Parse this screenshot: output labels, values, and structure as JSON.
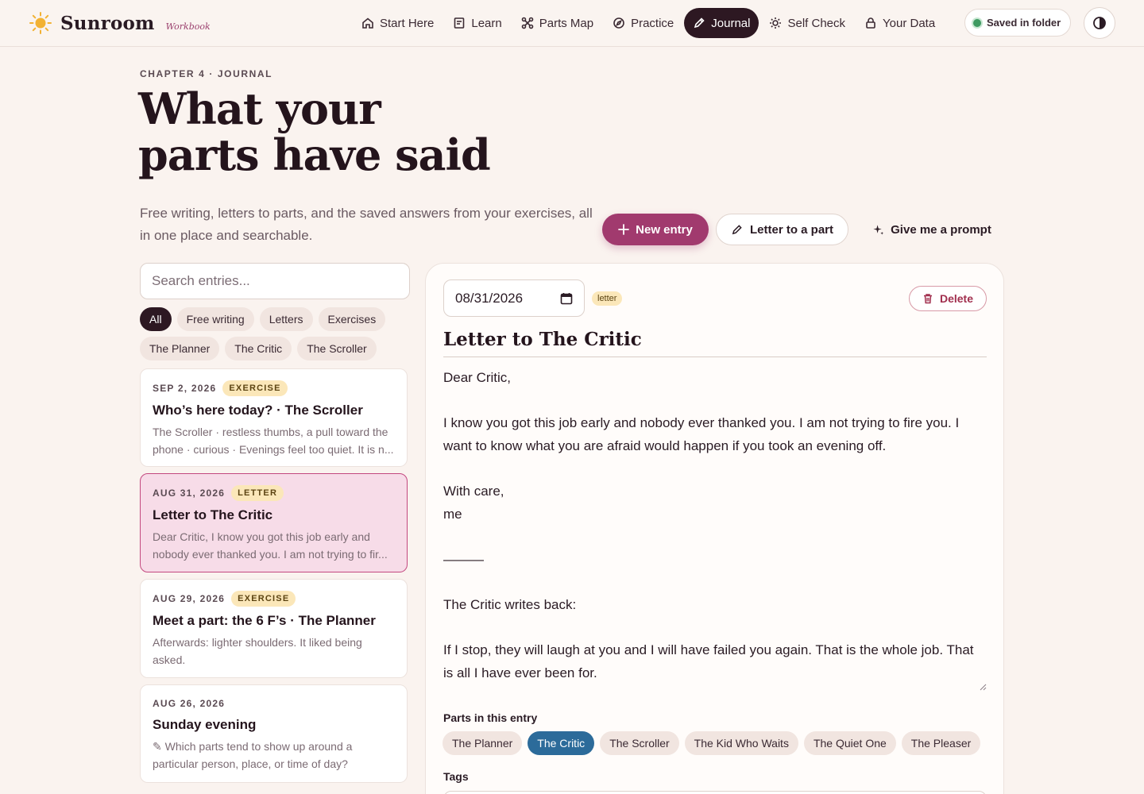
{
  "brand": {
    "name": "Sunroom",
    "sub": "Workbook"
  },
  "nav": [
    {
      "label": "Start Here",
      "icon": "home-icon"
    },
    {
      "label": "Learn",
      "icon": "book-icon"
    },
    {
      "label": "Parts Map",
      "icon": "nodes-icon"
    },
    {
      "label": "Practice",
      "icon": "compass-icon"
    },
    {
      "label": "Journal",
      "icon": "pencil-icon",
      "active": true
    },
    {
      "label": "Self Check",
      "icon": "sun-icon"
    },
    {
      "label": "Your Data",
      "icon": "lock-icon"
    }
  ],
  "status": {
    "saved_label": "Saved in folder"
  },
  "header": {
    "eyebrow": "CHAPTER 4 · JOURNAL",
    "title_line1": "What your",
    "title_line2": "parts have said",
    "description": "Free writing, letters to parts, and the saved answers from your exercises, all in one place and searchable."
  },
  "actions": {
    "new_entry": "New entry",
    "letter": "Letter to a part",
    "prompt": "Give me a prompt"
  },
  "search": {
    "placeholder": "Search entries..."
  },
  "filters": [
    "All",
    "Free writing",
    "Letters",
    "Exercises",
    "The Planner",
    "The Critic",
    "The Scroller"
  ],
  "entries": [
    {
      "date": "SEP 2, 2026",
      "badge": "EXERCISE",
      "title": "Who’s here today? · The Scroller",
      "preview": "The Scroller · restless thumbs, a pull toward the phone · curious · Evenings feel too quiet. It is n..."
    },
    {
      "date": "AUG 31, 2026",
      "badge": "LETTER",
      "title": "Letter to The Critic",
      "preview": "Dear Critic, I know you got this job early and nobody ever thanked you. I am not trying to fir..."
    },
    {
      "date": "AUG 29, 2026",
      "badge": "EXERCISE",
      "title": "Meet a part: the 6 F’s · The Planner",
      "preview": "Afterwards: lighter shoulders. It liked being asked."
    },
    {
      "date": "AUG 26, 2026",
      "badge": "",
      "title": "Sunday evening",
      "preview": "✎ Which parts tend to show up around a particular person, place, or time of day? Sunday..."
    }
  ],
  "editor": {
    "date": "08/31/2026",
    "type": "letter",
    "delete_label": "Delete",
    "title": "Letter to The Critic",
    "body": "Dear Critic,\n\nI know you got this job early and nobody ever thanked you. I am not trying to fire you. I want to know what you are afraid would happen if you took an evening off.\n\nWith care,\nme\n\n———\n\nThe Critic writes back:\n\nIf I stop, they will laugh at you and I will have failed you again. That is the whole job. That is all I have ever been for.",
    "parts_label": "Parts in this entry",
    "parts": [
      "The Planner",
      "The Critic",
      "The Scroller",
      "The Kid Who Waits",
      "The Quiet One",
      "The Pleaser"
    ],
    "tags_label": "Tags"
  },
  "colors": {
    "accent": "#a13a6e",
    "dark": "#2d1822",
    "selected_part": "#2c6b9a",
    "badge": "#fbe7b9"
  }
}
